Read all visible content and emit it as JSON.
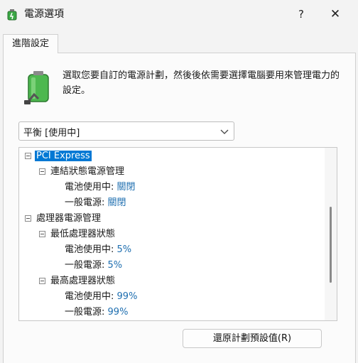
{
  "window": {
    "title": "電源選項",
    "help_label": "?",
    "close_label": "✕"
  },
  "tabs": [
    {
      "label": "進階設定",
      "selected": true
    }
  ],
  "description": "選取您要自訂的電源計劃，然後後依需要選擇電腦要用來管理電力的設定。",
  "plan_select": {
    "value": "平衡 [使用中]"
  },
  "tree": {
    "root": {
      "label": "PCI Express",
      "children": [
        {
          "label": "連結狀態電源管理",
          "settings": [
            {
              "label": "電池使用中:",
              "value": "關閉"
            },
            {
              "label": "一般電源:",
              "value": "關閉"
            }
          ]
        }
      ]
    },
    "processor": {
      "label": "處理器電源管理",
      "children": [
        {
          "label": "最低處理器狀態",
          "settings": [
            {
              "label": "電池使用中:",
              "value": "5%"
            },
            {
              "label": "一般電源:",
              "value": "5%"
            }
          ]
        },
        {
          "label": "最高處理器狀態",
          "settings": [
            {
              "label": "電池使用中:",
              "value": "99%"
            },
            {
              "label": "一般電源:",
              "value": "99%"
            }
          ]
        }
      ]
    }
  },
  "buttons": {
    "restore_label": "還原計劃預設值(R)"
  },
  "colors": {
    "accent": "#0078d4",
    "value_text": "#1f6fb0"
  }
}
